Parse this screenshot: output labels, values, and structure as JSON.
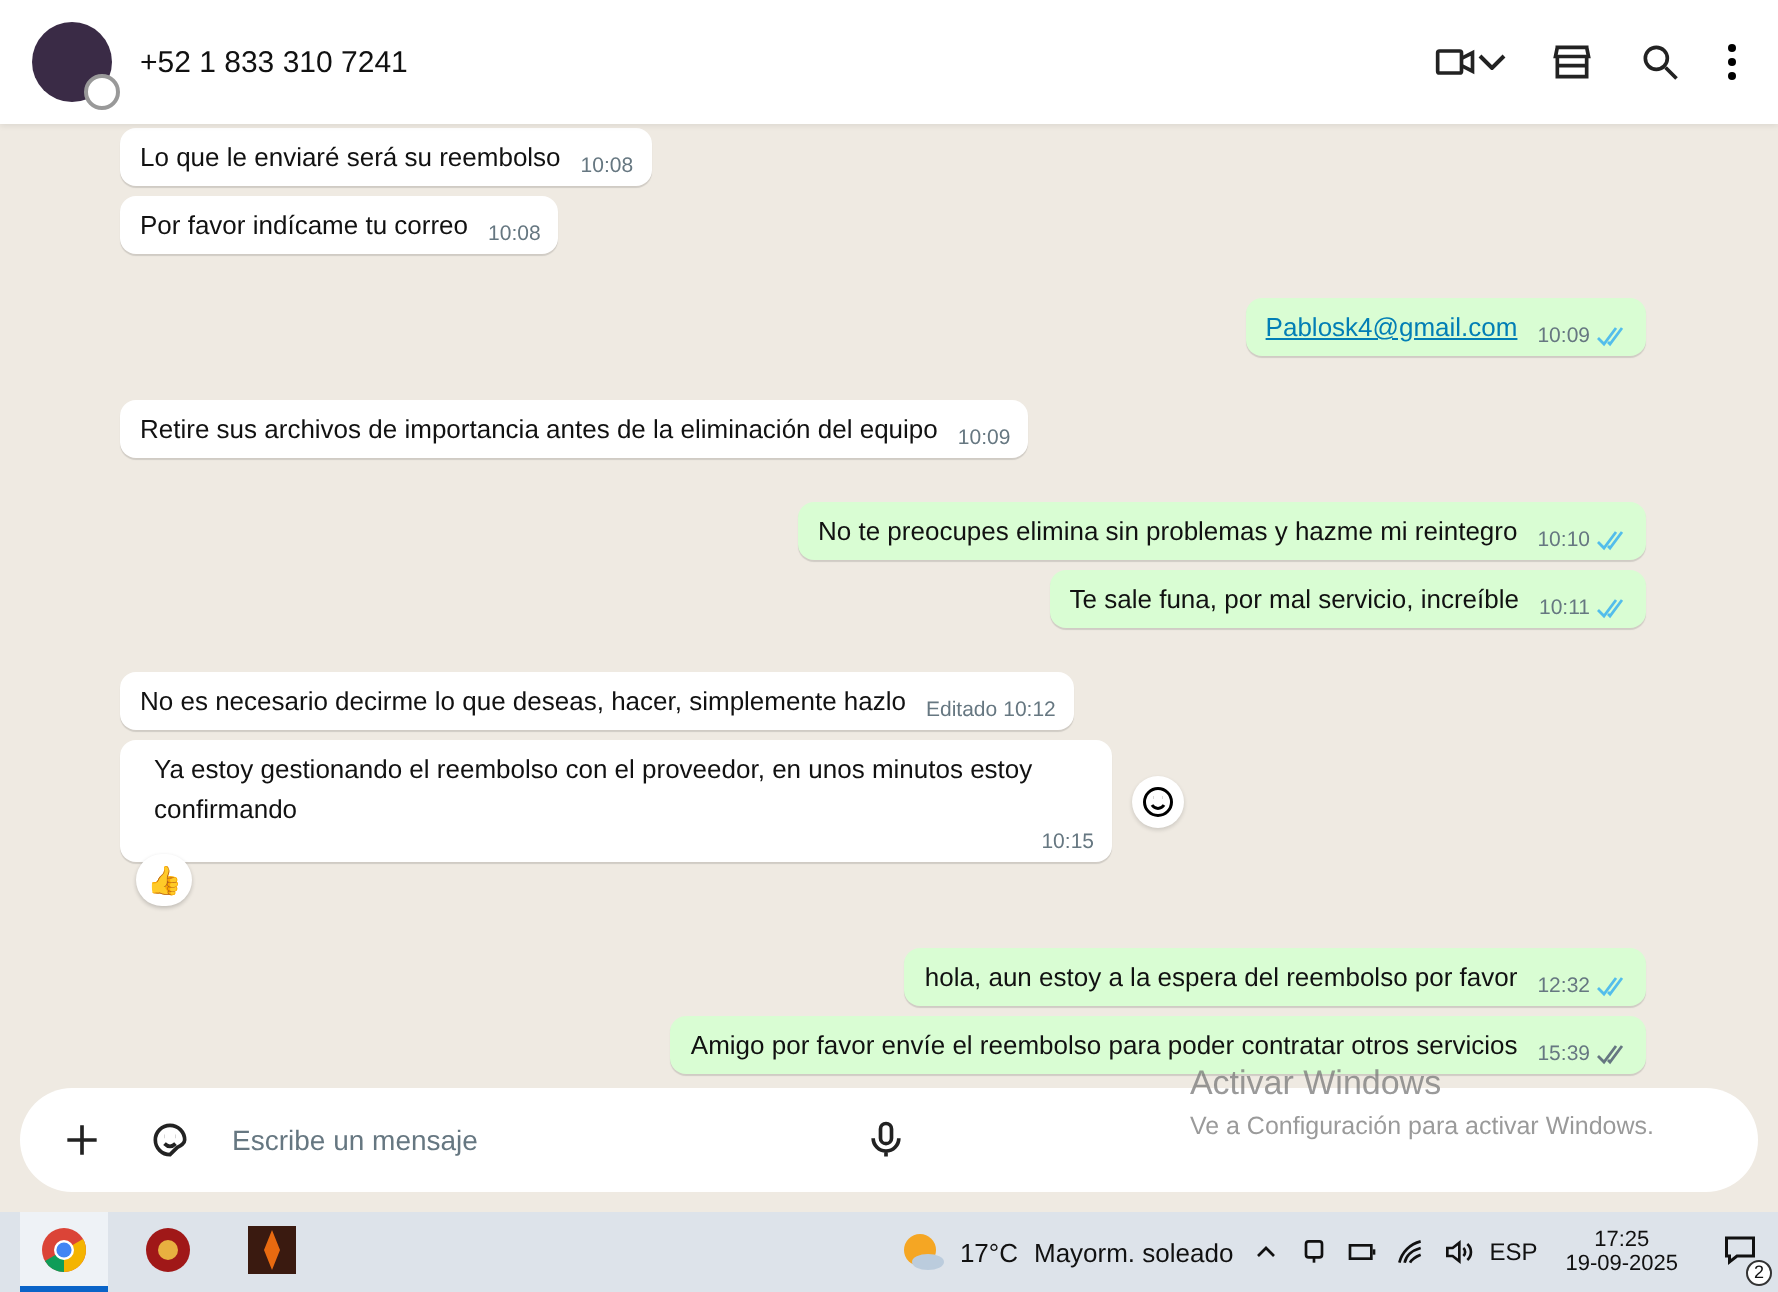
{
  "header": {
    "contact": "+52 1 833 310 7241"
  },
  "groups": [
    {
      "outgoing": false,
      "messages": [
        {
          "text": "Lo que le enviaré será su reembolso",
          "time": "10:08"
        },
        {
          "text": "Por favor indícame tu correo",
          "time": "10:08"
        }
      ]
    },
    {
      "outgoing": true,
      "messages": [
        {
          "text": "Pablosk4@gmail.com",
          "time": "10:09",
          "link": true,
          "read": true
        }
      ]
    },
    {
      "outgoing": false,
      "messages": [
        {
          "text": "Retire sus archivos de importancia antes de la eliminación del equipo",
          "time": "10:09"
        }
      ]
    },
    {
      "outgoing": true,
      "messages": [
        {
          "text": "No te preocupes elimina sin problemas y hazme mi reintegro",
          "time": "10:10",
          "read": true
        },
        {
          "text": "Te sale funa, por mal servicio, increíble",
          "time": "10:11",
          "read": true
        }
      ]
    },
    {
      "outgoing": false,
      "messages": [
        {
          "text": "No es necesario decirme lo que deseas, hacer, simplemente hazlo",
          "time": "10:12",
          "edited": "Editado"
        },
        {
          "text": "Ya estoy gestionando el reembolso con el proveedor, en unos minutos estoy confirmando",
          "time": "10:15",
          "reaction": "👍",
          "react_button": true
        }
      ]
    },
    {
      "outgoing": true,
      "messages": [
        {
          "text": "hola, aun estoy a la espera del reembolso por favor",
          "time": "12:32",
          "read": true
        },
        {
          "text": "Amigo por favor envíe el reembolso para poder contratar otros servicios",
          "time": "15:39",
          "read": false
        }
      ]
    }
  ],
  "composer": {
    "placeholder": "Escribe un mensaje"
  },
  "os_notice": {
    "title": "Activar Windows",
    "subtitle": "Ve a Configuración para activar Windows."
  },
  "taskbar": {
    "weather_temp": "17°C",
    "weather_text": "Mayorm. soleado",
    "language": "ESP",
    "time": "17:25",
    "date": "19-09-2025",
    "notifications": "2"
  }
}
